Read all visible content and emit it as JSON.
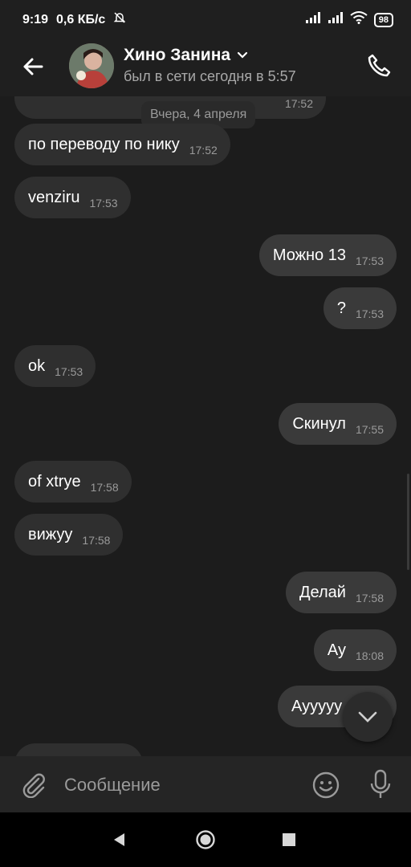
{
  "status_bar": {
    "time": "9:19",
    "speed": "0,6 КБ/с",
    "battery": "98"
  },
  "header": {
    "contact_name": "Хино Занина",
    "status": "был в сети сегодня в 5:57"
  },
  "chat": {
    "partial_top_time": "17:52",
    "date_divider": "Вчера, 4 апреля",
    "messages": [
      {
        "direction": "in",
        "text": "по переводу по нику",
        "time": "17:52"
      },
      {
        "direction": "in",
        "text": "venziru",
        "time": "17:53"
      },
      {
        "direction": "out",
        "text": "Можно 13",
        "time": "17:53"
      },
      {
        "direction": "out",
        "text": "?",
        "time": "17:53"
      },
      {
        "direction": "in",
        "text": "ok",
        "time": "17:53"
      },
      {
        "direction": "out",
        "text": "Скинул",
        "time": "17:55"
      },
      {
        "direction": "in",
        "text": "of xtrye",
        "time": "17:58"
      },
      {
        "direction": "in",
        "text": "вижуу",
        "time": "17:58"
      },
      {
        "direction": "out",
        "text": "Делай",
        "time": "17:58"
      },
      {
        "direction": "out",
        "text": "Ау",
        "time": "18:08"
      },
      {
        "direction": "out",
        "text": "Ауyyyy",
        "time": ""
      }
    ]
  },
  "composer": {
    "placeholder": "Сообщение"
  },
  "icons": {
    "back": "arrow-left-icon",
    "call": "phone-icon",
    "attach": "paperclip-icon",
    "emoji": "smiley-icon",
    "mic": "microphone-icon",
    "scroll_down": "chevron-down-icon"
  },
  "colors": {
    "background": "#1c1c1c",
    "bubble_in": "#2f2f2f",
    "bubble_out": "#3a3a3a",
    "time": "#9a9a9a"
  }
}
